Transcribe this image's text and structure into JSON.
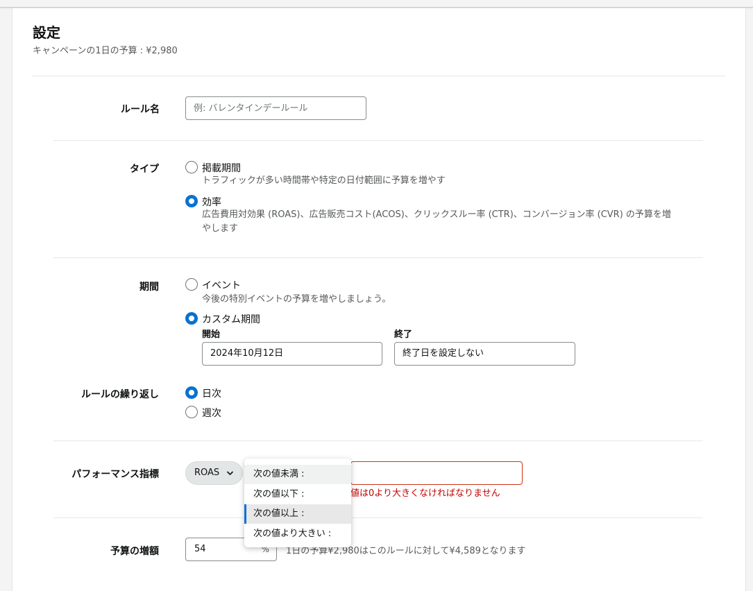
{
  "header": {
    "title": "設定",
    "subtitle": "キャンペーンの1日の予算 : ¥2,980"
  },
  "rule_name": {
    "label": "ルール名",
    "placeholder": "例: バレンタインデールール",
    "value": ""
  },
  "type": {
    "label": "タイプ",
    "options": [
      {
        "label": "掲載期間",
        "description": "トラフィックが多い時間帯や特定の日付範囲に予算を増やす",
        "selected": false
      },
      {
        "label": "効率",
        "description_line1": "広告費用対効果 (ROAS)、広告販売コスト(ACOS)、クリックスルー率 (CTR)、コンバージョン率 (CVR) の予算を増",
        "description_line2": "やします",
        "selected": true
      }
    ]
  },
  "period": {
    "label": "期間",
    "options": [
      {
        "label": "イベント",
        "description": "今後の特別イベントの予算を増やしましょう。",
        "selected": false
      },
      {
        "label": "カスタム期間",
        "selected": true
      }
    ],
    "start": {
      "label": "開始",
      "value": "2024年10月12日"
    },
    "end": {
      "label": "終了",
      "value": "終了日を設定しない"
    }
  },
  "recurrence": {
    "label": "ルールの繰り返し",
    "options": [
      {
        "label": "日次",
        "selected": true
      },
      {
        "label": "週次",
        "selected": false
      }
    ]
  },
  "performance": {
    "label": "パフォーマンス指標",
    "metric": "ROAS",
    "error": "値は0より大きくなければなりません",
    "dropdown": [
      {
        "label": "次の値未満 :",
        "state": "hover"
      },
      {
        "label": "次の値以下 :",
        "state": "normal"
      },
      {
        "label": "次の値以上 :",
        "state": "selected"
      },
      {
        "label": "次の値より大きい :",
        "state": "normal"
      }
    ]
  },
  "budget_increase": {
    "label": "予算の増額",
    "value": "54",
    "unit": "%",
    "note": "1日の予算¥2,980はこのルールに対して¥4,589となります"
  },
  "colors": {
    "accent": "#0972d3",
    "error": "#d13212"
  }
}
